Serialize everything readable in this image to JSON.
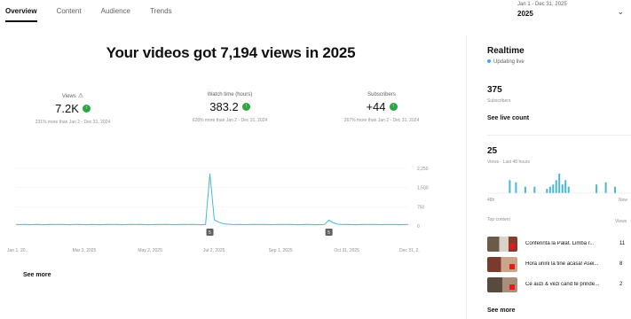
{
  "tabs": [
    {
      "label": "Overview",
      "active": true
    },
    {
      "label": "Content",
      "active": false
    },
    {
      "label": "Audience",
      "active": false
    },
    {
      "label": "Trends",
      "active": false
    }
  ],
  "date_range": {
    "range": "Jan 1 - Dec 31, 2025",
    "year": "2025"
  },
  "headline": "Your videos got 7,194 views in 2025",
  "metrics": [
    {
      "label": "Views",
      "value": "7.2K",
      "compare": "231% more than Jan 2 - Dec 31, 2024",
      "icon": "warning-icon"
    },
    {
      "label": "Watch time (hours)",
      "value": "383.2",
      "compare": "628% more than Jan 2 - Dec 31, 2024"
    },
    {
      "label": "Subscribers",
      "value": "+44",
      "compare": "267% more than Jan 2 - Dec 31, 2024"
    }
  ],
  "chart_data": {
    "type": "line",
    "x_ticks": [
      "Jan 1, 20..",
      "Mar 3, 2025",
      "May 2, 2025",
      "Jul 2, 2025",
      "Sep 1, 2025",
      "Oct 31, 2025",
      "Dec 31, 2."
    ],
    "y_ticks": [
      "2,250",
      "1,500",
      "750",
      "0"
    ],
    "ylim": [
      0,
      2250
    ],
    "series": [
      {
        "values": [
          60,
          55,
          60,
          50,
          55,
          60,
          50,
          55,
          60,
          55,
          60,
          55,
          50,
          55,
          60,
          55,
          50,
          60,
          55,
          50,
          55,
          60,
          55,
          60,
          50,
          55,
          60,
          55,
          60,
          55,
          50,
          55,
          60,
          55,
          60,
          55,
          50,
          55,
          60,
          55,
          60,
          55,
          50,
          60,
          2050,
          240,
          150,
          90,
          70,
          60,
          55,
          60,
          50,
          55,
          60,
          55,
          60,
          55,
          50,
          55,
          60,
          55,
          60,
          55,
          50,
          55,
          60,
          55,
          50,
          55,
          60,
          230,
          120,
          70,
          55,
          60,
          55,
          50,
          55,
          60,
          55,
          60,
          55,
          50,
          55,
          60,
          55,
          50,
          55,
          60
        ]
      }
    ],
    "markers": [
      {
        "label": "5",
        "x_index": 44
      },
      {
        "label": "5",
        "x_index": 71
      }
    ],
    "color": "#47b9d6"
  },
  "see_more_left": "See more",
  "realtime": {
    "title": "Realtime",
    "status": "Updating live",
    "subscribers": "375",
    "subscribers_label": "Subscribers",
    "live_count_button": "See live count",
    "views": "25",
    "views_label": "Views · Last 48 hours",
    "mini_chart": {
      "values": [
        0,
        0,
        0,
        0,
        0,
        0,
        0,
        6,
        0,
        5,
        0,
        0,
        3,
        0,
        0,
        3,
        0,
        0,
        0,
        2,
        3,
        4,
        6,
        9,
        4,
        6,
        3,
        0,
        0,
        0,
        0,
        0,
        0,
        0,
        0,
        4,
        0,
        0,
        5,
        0,
        0,
        3,
        0
      ],
      "x_labels": [
        "48h",
        "Now"
      ]
    },
    "top_content_label": "Top content",
    "top_content_col": "Views",
    "top_content": [
      {
        "title": "Conferinta la Palat. Limba r...",
        "views": "11"
      },
      {
        "title": "Hora unirii la tine acasa! Asei...",
        "views": "8"
      },
      {
        "title": "Ce auzi & vezi cand te prinde...",
        "views": "2"
      }
    ],
    "see_more": "See more"
  },
  "colors": {
    "accent": "#47b9d6",
    "positive": "#2ba640",
    "live": "#3ea6ff"
  }
}
